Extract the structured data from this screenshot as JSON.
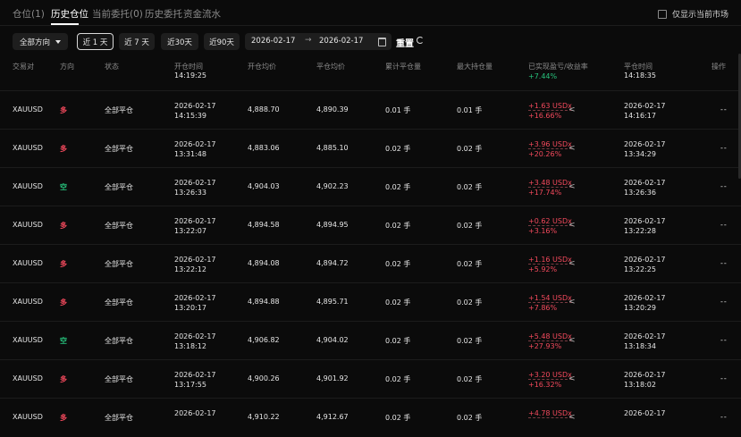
{
  "tabs": [
    {
      "label": "仓位(1)",
      "active": false
    },
    {
      "label": "历史仓位",
      "active": true
    },
    {
      "label": "当前委托(0)",
      "active": false
    },
    {
      "label": "历史委托",
      "active": false
    },
    {
      "label": "资金流水",
      "active": false
    }
  ],
  "only_current_market": "仅显示当前市场",
  "filters": {
    "direction": "全部方向",
    "range_1d": "近 1 天",
    "range_7d": "近 7 天",
    "range_30d": "近30天",
    "range_90d": "近90天",
    "start_date": "2026-02-17",
    "end_date": "2026-02-17",
    "reset": "重置"
  },
  "columns": [
    "交易对",
    "方向",
    "状态",
    "开仓时间",
    "开仓均价",
    "平仓均价",
    "累计平仓量",
    "最大持仓量",
    "已实现盈亏/收益率",
    "平仓时间",
    "操作"
  ],
  "partial_row": {
    "open_time": "14:19:25",
    "pnl_rate": "+7.44%",
    "close_time": "14:18:35"
  },
  "rows": [
    {
      "pair": "XAUUSD",
      "dir": "多",
      "dir_type": "long",
      "status": "全部平仓",
      "open_date": "2026-02-17",
      "open_time": "14:15:39",
      "open_avg": "4,888.70",
      "close_avg": "4,890.39",
      "closed_qty": "0.01 手",
      "max_qty": "0.01 手",
      "pnl": "+1.63 USDx",
      "pnl_rate": "+16.66%",
      "close_date": "2026-02-17",
      "close_time": "14:16:17",
      "action": "--"
    },
    {
      "pair": "XAUUSD",
      "dir": "多",
      "dir_type": "long",
      "status": "全部平仓",
      "open_date": "2026-02-17",
      "open_time": "13:31:48",
      "open_avg": "4,883.06",
      "close_avg": "4,885.10",
      "closed_qty": "0.02 手",
      "max_qty": "0.02 手",
      "pnl": "+3.96 USDx",
      "pnl_rate": "+20.26%",
      "close_date": "2026-02-17",
      "close_time": "13:34:29",
      "action": "--"
    },
    {
      "pair": "XAUUSD",
      "dir": "空",
      "dir_type": "short",
      "status": "全部平仓",
      "open_date": "2026-02-17",
      "open_time": "13:26:33",
      "open_avg": "4,904.03",
      "close_avg": "4,902.23",
      "closed_qty": "0.02 手",
      "max_qty": "0.02 手",
      "pnl": "+3.48 USDx",
      "pnl_rate": "+17.74%",
      "close_date": "2026-02-17",
      "close_time": "13:26:36",
      "action": "--"
    },
    {
      "pair": "XAUUSD",
      "dir": "多",
      "dir_type": "long",
      "status": "全部平仓",
      "open_date": "2026-02-17",
      "open_time": "13:22:07",
      "open_avg": "4,894.58",
      "close_avg": "4,894.95",
      "closed_qty": "0.02 手",
      "max_qty": "0.02 手",
      "pnl": "+0.62 USDx",
      "pnl_rate": "+3.16%",
      "close_date": "2026-02-17",
      "close_time": "13:22:28",
      "action": "--"
    },
    {
      "pair": "XAUUSD",
      "dir": "多",
      "dir_type": "long",
      "status": "全部平仓",
      "open_date": "2026-02-17",
      "open_time": "13:22:12",
      "open_avg": "4,894.08",
      "close_avg": "4,894.72",
      "closed_qty": "0.02 手",
      "max_qty": "0.02 手",
      "pnl": "+1.16 USDx",
      "pnl_rate": "+5.92%",
      "close_date": "2026-02-17",
      "close_time": "13:22:25",
      "action": "--"
    },
    {
      "pair": "XAUUSD",
      "dir": "多",
      "dir_type": "long",
      "status": "全部平仓",
      "open_date": "2026-02-17",
      "open_time": "13:20:17",
      "open_avg": "4,894.88",
      "close_avg": "4,895.71",
      "closed_qty": "0.02 手",
      "max_qty": "0.02 手",
      "pnl": "+1.54 USDx",
      "pnl_rate": "+7.86%",
      "close_date": "2026-02-17",
      "close_time": "13:20:29",
      "action": "--"
    },
    {
      "pair": "XAUUSD",
      "dir": "空",
      "dir_type": "short",
      "status": "全部平仓",
      "open_date": "2026-02-17",
      "open_time": "13:18:12",
      "open_avg": "4,906.82",
      "close_avg": "4,904.02",
      "closed_qty": "0.02 手",
      "max_qty": "0.02 手",
      "pnl": "+5.48 USDx",
      "pnl_rate": "+27.93%",
      "close_date": "2026-02-17",
      "close_time": "13:18:34",
      "action": "--"
    },
    {
      "pair": "XAUUSD",
      "dir": "多",
      "dir_type": "long",
      "status": "全部平仓",
      "open_date": "2026-02-17",
      "open_time": "13:17:55",
      "open_avg": "4,900.26",
      "close_avg": "4,901.92",
      "closed_qty": "0.02 手",
      "max_qty": "0.02 手",
      "pnl": "+3.20 USDx",
      "pnl_rate": "+16.32%",
      "close_date": "2026-02-17",
      "close_time": "13:18:02",
      "action": "--"
    },
    {
      "pair": "XAUUSD",
      "dir": "多",
      "dir_type": "long",
      "status": "全部平仓",
      "open_date": "2026-02-17",
      "open_time": "",
      "open_avg": "4,910.22",
      "close_avg": "4,912.67",
      "closed_qty": "0.02 手",
      "max_qty": "0.02 手",
      "pnl": "+4.78 USDx",
      "pnl_rate": "",
      "close_date": "2026-02-17",
      "close_time": "",
      "action": "--"
    }
  ],
  "colors": {
    "background": "#0b0b0b",
    "long": "#f2495c",
    "short": "#27c27c",
    "muted": "#8a8a8a"
  }
}
